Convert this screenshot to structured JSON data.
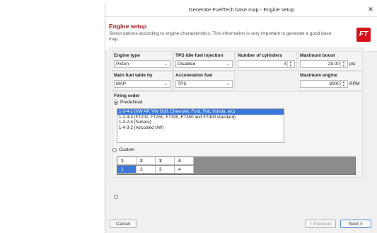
{
  "window": {
    "title": "Generate FuelTech base map - Engine setup",
    "close_glyph": "✕"
  },
  "header": {
    "title": "Engine setup",
    "description": "Select options according to engine characteristics. This information is very important to generate a good base map.",
    "logo_text": "FT"
  },
  "fields": {
    "engine_type": {
      "label": "Engine type",
      "value": "Piston"
    },
    "tps_idle": {
      "label": "TPS idle fuel injection",
      "value": "Disabled"
    },
    "cylinders": {
      "label": "Number of cylinders",
      "value": "4"
    },
    "max_boost": {
      "label": "Maximum boost",
      "value": "29.00",
      "unit": "psi"
    },
    "main_fuel_table": {
      "label": "Main fuel table by",
      "value": "MAP"
    },
    "accel_fuel": {
      "label": "Acceleration fuel",
      "value": "TPS"
    },
    "max_engine": {
      "label": "Maximum engine",
      "value": "8000",
      "unit": "RPM"
    }
  },
  "firing_order": {
    "label": "Firing order",
    "predefined_label": "Predefined",
    "custom_label": "Custom",
    "options": [
      "1-3-4-2 (VW AP, VW Golf, Chevrolet, Ford, Fiat, Honda, etc)",
      "1-2-4-3 (FT200, FT250, FT300, FT350 and FT400 standard)",
      "1-3-2-4 (Subaru)",
      "1-4-3-2 (Aircooled VW)"
    ],
    "custom_headers": [
      "1",
      "2",
      "3",
      "4"
    ],
    "custom_values": [
      "1",
      "2",
      "3",
      "4"
    ]
  },
  "footer": {
    "cancel": "Cancel",
    "previous": "< Previous",
    "next": "Next >"
  },
  "colors": {
    "accent": "#a0131a",
    "selection": "#3b78d8",
    "logo": "#d5101a"
  }
}
